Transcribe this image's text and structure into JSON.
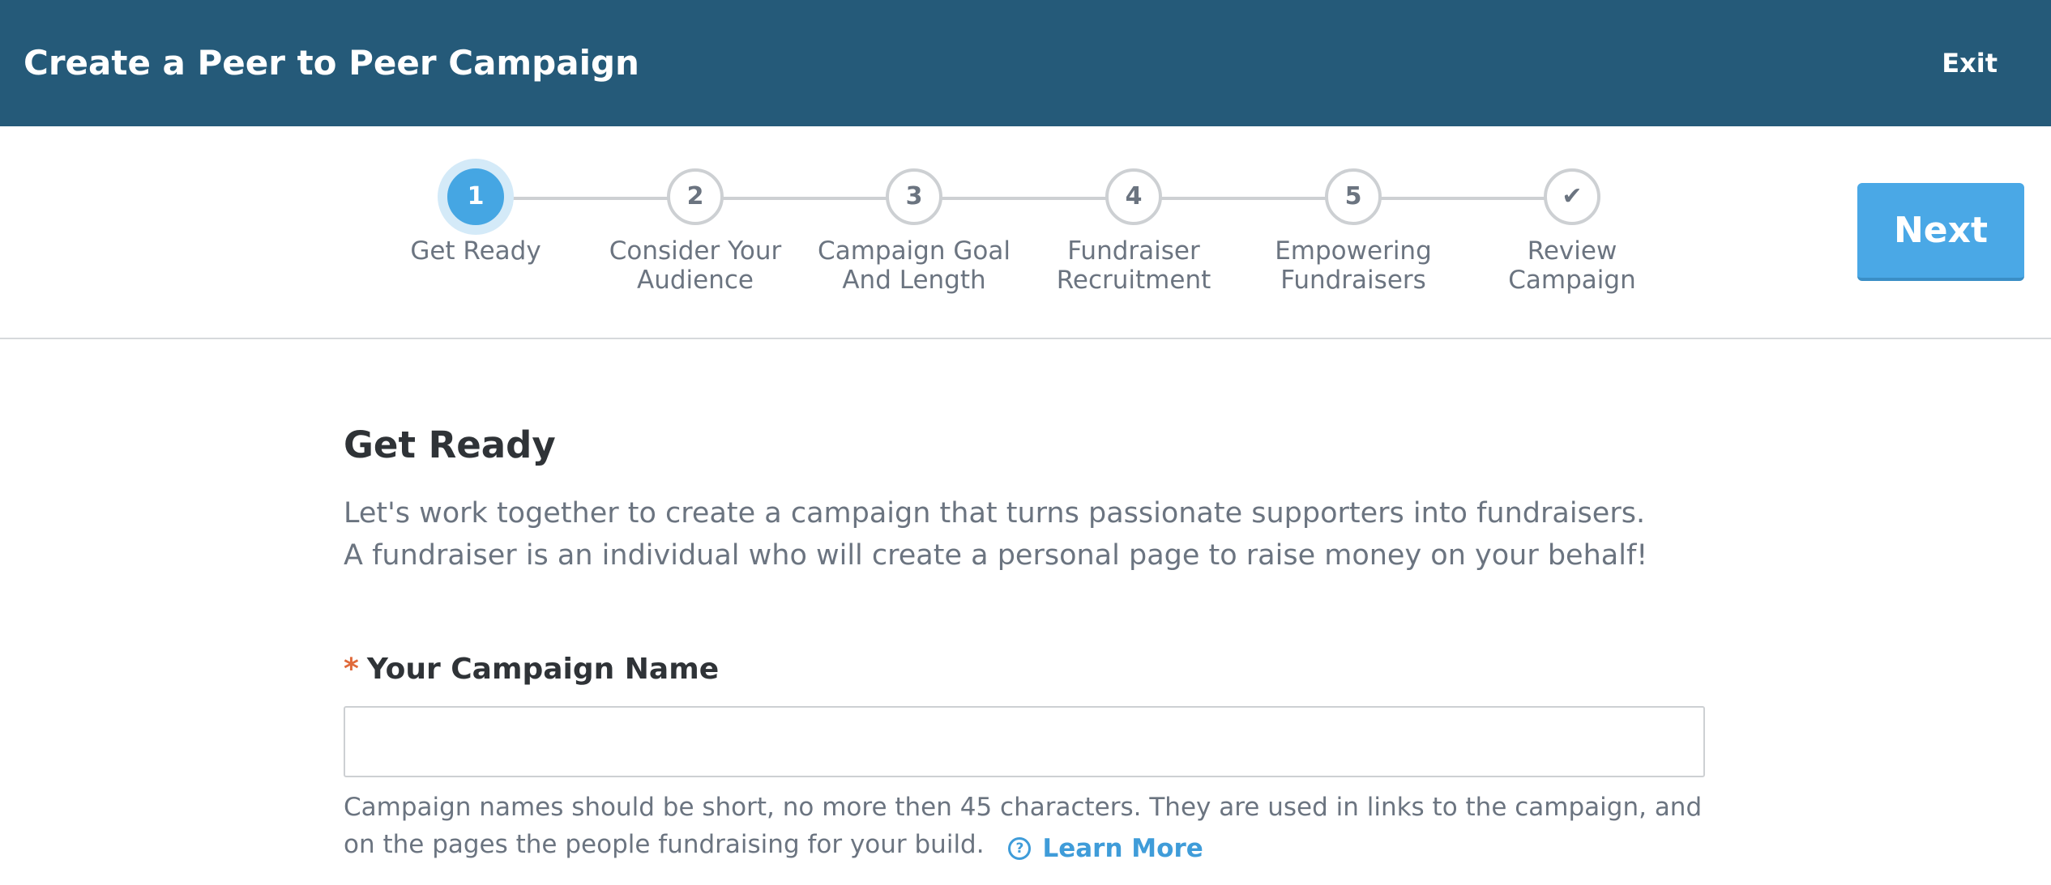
{
  "header": {
    "title": "Create a Peer to Peer Campaign",
    "exit_label": "Exit"
  },
  "stepper": {
    "steps": [
      {
        "number": "1",
        "label": "Get Ready",
        "state": "active"
      },
      {
        "number": "2",
        "label": "Consider Your Audience",
        "state": "upcoming"
      },
      {
        "number": "3",
        "label": "Campaign Goal And Length",
        "state": "upcoming"
      },
      {
        "number": "4",
        "label": "Fundraiser Recruitment",
        "state": "upcoming"
      },
      {
        "number": "5",
        "label": "Empowering Fundraisers",
        "state": "upcoming"
      },
      {
        "number": "✔",
        "label": "Review Campaign",
        "state": "upcoming",
        "icon": "check-icon"
      }
    ],
    "next_label": "Next"
  },
  "main": {
    "title": "Get Ready",
    "intro": "Let's work together to create a campaign that turns passionate supporters into fundraisers. A fundraiser is an individual who will create a personal page to raise money on your behalf!",
    "campaign_name": {
      "required_marker": "*",
      "label": "Your Campaign Name",
      "value": "",
      "placeholder": "",
      "helper": "Campaign names should be short, no more then 45 characters. They are used in links to the campaign, and on the pages the people fundraising for your build.",
      "learn_more_icon": "?",
      "learn_more_label": "Learn More"
    }
  },
  "colors": {
    "header_bg": "#255a79",
    "accent": "#45a6e3",
    "required": "#e06a3b",
    "muted_text": "#6b7480"
  }
}
